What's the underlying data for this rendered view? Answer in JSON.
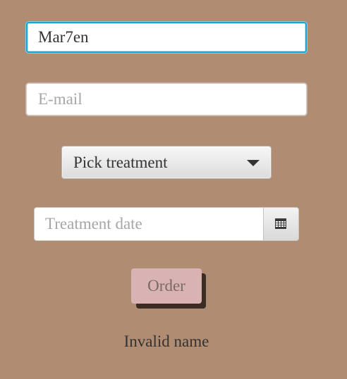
{
  "form": {
    "name": {
      "value": "Mar7en",
      "focused": true
    },
    "email": {
      "placeholder": "E-mail",
      "value": ""
    },
    "treatment": {
      "selected": "Pick treatment"
    },
    "date": {
      "placeholder": "Treatment date",
      "value": "",
      "icon": "calendar-icon"
    },
    "order_button": {
      "label": "Order"
    },
    "error": "Invalid name"
  },
  "colors": {
    "background": "#b08c72",
    "focus_border": "#1aa3d0",
    "order_button": "#d9b2b4",
    "order_shadow": "#3b2d24"
  }
}
